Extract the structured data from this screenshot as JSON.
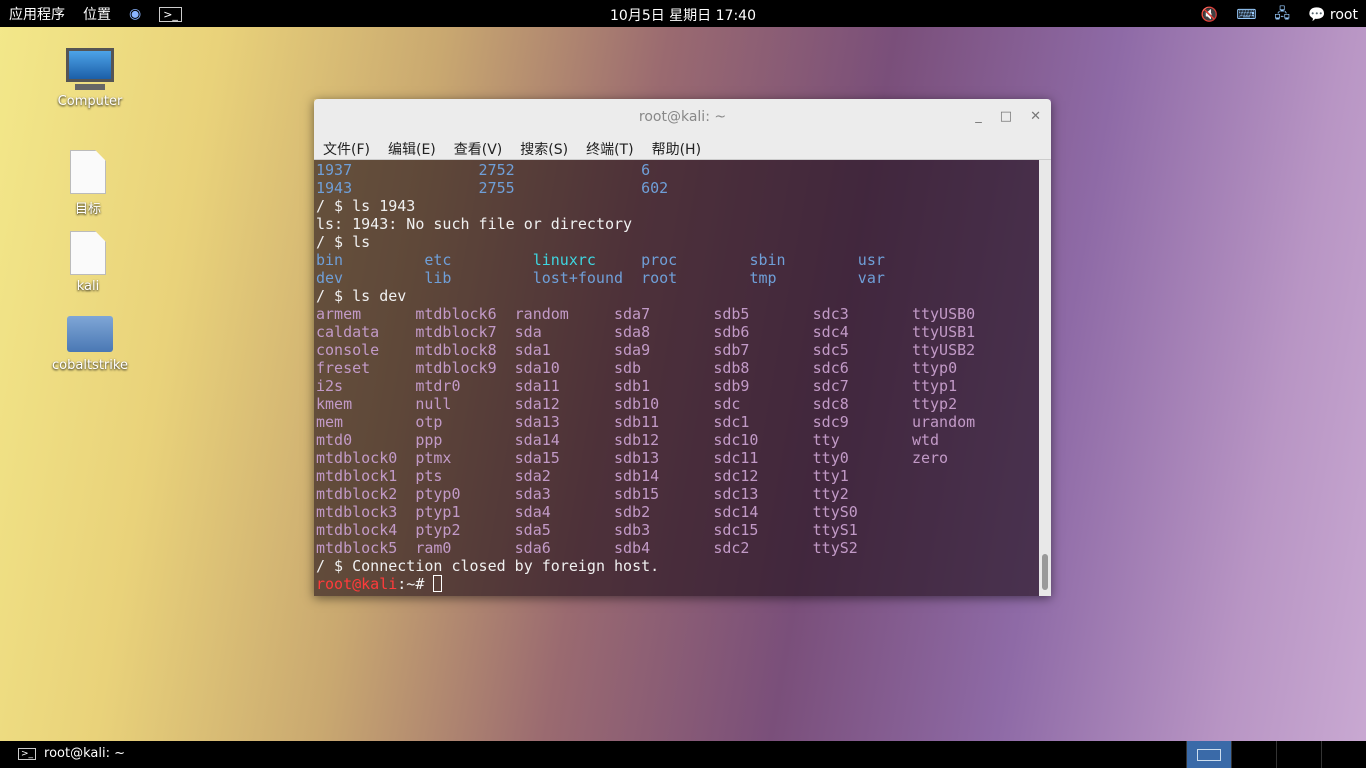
{
  "topbar": {
    "apps": "应用程序",
    "places": "位置",
    "clock": "10月5日 星期日 17:40",
    "user": "root"
  },
  "desktop": [
    "Computer",
    "目标",
    "kali",
    "cobaltstrike"
  ],
  "window": {
    "title": "root@kali: ~",
    "menu": [
      "文件(F)",
      "编辑(E)",
      "查看(V)",
      "搜索(S)",
      "终端(T)",
      "帮助(H)"
    ]
  },
  "terminal": {
    "top_rows": [
      [
        "1937",
        "2752",
        "6"
      ],
      [
        "1943",
        "2755",
        "602"
      ]
    ],
    "line1": "/ $ ls 1943",
    "line2": "ls: 1943: No such file or directory",
    "line3": "/ $ ls",
    "ls_rows": [
      [
        "bin",
        "etc",
        "linuxrc",
        "proc",
        "sbin",
        "usr"
      ],
      [
        "dev",
        "lib",
        "lost+found",
        "root",
        "tmp",
        "var"
      ]
    ],
    "line4": "/ $ ls dev",
    "dev_rows": [
      [
        "armem",
        "mtdblock6",
        "random",
        "sda7",
        "sdb5",
        "sdc3",
        "ttyUSB0"
      ],
      [
        "caldata",
        "mtdblock7",
        "sda",
        "sda8",
        "sdb6",
        "sdc4",
        "ttyUSB1"
      ],
      [
        "console",
        "mtdblock8",
        "sda1",
        "sda9",
        "sdb7",
        "sdc5",
        "ttyUSB2"
      ],
      [
        "freset",
        "mtdblock9",
        "sda10",
        "sdb",
        "sdb8",
        "sdc6",
        "ttyp0"
      ],
      [
        "i2s",
        "mtdr0",
        "sda11",
        "sdb1",
        "sdb9",
        "sdc7",
        "ttyp1"
      ],
      [
        "kmem",
        "null",
        "sda12",
        "sdb10",
        "sdc",
        "sdc8",
        "ttyp2"
      ],
      [
        "mem",
        "otp",
        "sda13",
        "sdb11",
        "sdc1",
        "sdc9",
        "urandom"
      ],
      [
        "mtd0",
        "ppp",
        "sda14",
        "sdb12",
        "sdc10",
        "tty",
        "wtd"
      ],
      [
        "mtdblock0",
        "ptmx",
        "sda15",
        "sdb13",
        "sdc11",
        "tty0",
        "zero"
      ],
      [
        "mtdblock1",
        "pts",
        "sda2",
        "sdb14",
        "sdc12",
        "tty1",
        ""
      ],
      [
        "mtdblock2",
        "ptyp0",
        "sda3",
        "sdb15",
        "sdc13",
        "tty2",
        ""
      ],
      [
        "mtdblock3",
        "ptyp1",
        "sda4",
        "sdb2",
        "sdc14",
        "ttyS0",
        ""
      ],
      [
        "mtdblock4",
        "ptyp2",
        "sda5",
        "sdb3",
        "sdc15",
        "ttyS1",
        ""
      ],
      [
        "mtdblock5",
        "ram0",
        "sda6",
        "sdb4",
        "sdc2",
        "ttyS2",
        ""
      ]
    ],
    "closed": "/ $ Connection closed by foreign host.",
    "prompt_user": "root@kali",
    "prompt_rest": ":~# "
  },
  "taskbar": {
    "task": "root@kali: ~"
  }
}
